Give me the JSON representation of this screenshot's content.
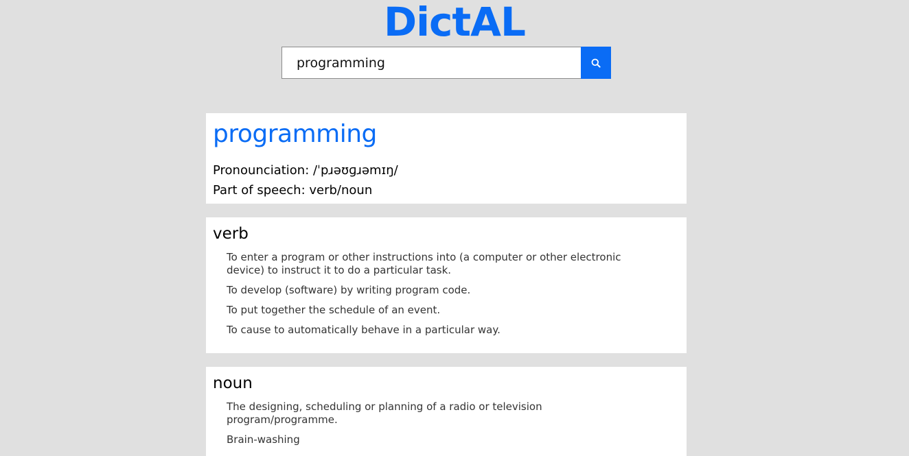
{
  "app": {
    "title": "DictAL"
  },
  "search": {
    "value": "programming",
    "button_icon": "search-icon"
  },
  "entry": {
    "word": "programming",
    "pronunciation_label": "Pronounciation: /ˈpɹəʊɡɹəmɪŋ/",
    "part_of_speech_label": "Part of speech: verb/noun"
  },
  "meanings": [
    {
      "pos": "verb",
      "definitions": [
        "To enter a program or other instructions into (a computer or other electronic device) to instruct it to do a particular task.",
        "To develop (software) by writing program code.",
        "To put together the schedule of an event.",
        "To cause to automatically behave in a particular way."
      ]
    },
    {
      "pos": "noun",
      "definitions": [
        "The designing, scheduling or planning of a radio or television program/programme.",
        "Brain-washing"
      ]
    }
  ],
  "colors": {
    "accent": "#0a6cf5",
    "background": "#e0e0e0"
  }
}
